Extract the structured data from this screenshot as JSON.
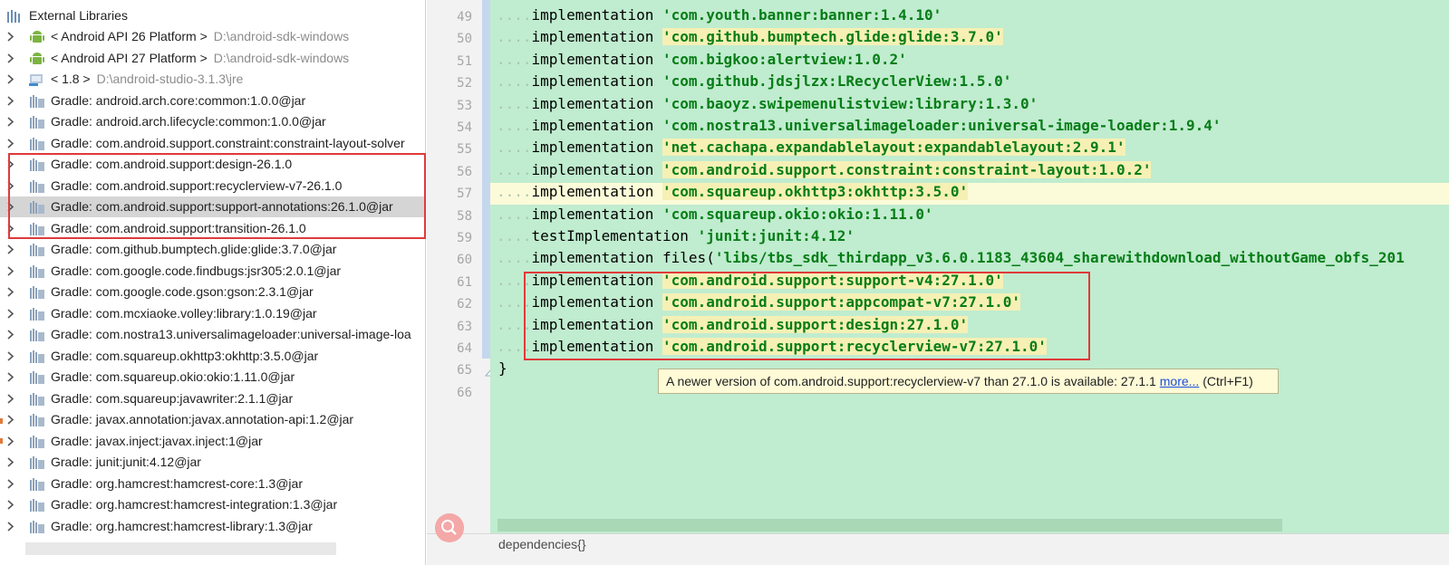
{
  "tree": {
    "root": {
      "label": "External Libraries",
      "icon": "library-icon"
    },
    "items": [
      {
        "label": "< Android API 26 Platform >",
        "path": "D:\\android-sdk-windows",
        "icon": "android-icon"
      },
      {
        "label": "< Android API 27 Platform >",
        "path": "D:\\android-sdk-windows",
        "icon": "android-icon"
      },
      {
        "label": "< 1.8 >",
        "path": "D:\\android-studio-3.1.3\\jre",
        "icon": "jdk-icon"
      },
      {
        "label": "Gradle: android.arch.core:common:1.0.0@jar",
        "path": "",
        "icon": "jar-library-icon"
      },
      {
        "label": "Gradle: android.arch.lifecycle:common:1.0.0@jar",
        "path": "",
        "icon": "jar-library-icon"
      },
      {
        "label": "Gradle: com.android.support.constraint:constraint-layout-solver",
        "path": "",
        "icon": "jar-library-icon"
      },
      {
        "label": "Gradle: com.android.support:design-26.1.0",
        "path": "",
        "icon": "jar-library-icon"
      },
      {
        "label": "Gradle: com.android.support:recyclerview-v7-26.1.0",
        "path": "",
        "icon": "jar-library-icon"
      },
      {
        "label": "Gradle: com.android.support:support-annotations:26.1.0@jar",
        "path": "",
        "icon": "jar-library-icon"
      },
      {
        "label": "Gradle: com.android.support:transition-26.1.0",
        "path": "",
        "icon": "jar-library-icon"
      },
      {
        "label": "Gradle: com.github.bumptech.glide:glide:3.7.0@jar",
        "path": "",
        "icon": "jar-library-icon"
      },
      {
        "label": "Gradle: com.google.code.findbugs:jsr305:2.0.1@jar",
        "path": "",
        "icon": "jar-library-icon"
      },
      {
        "label": "Gradle: com.google.code.gson:gson:2.3.1@jar",
        "path": "",
        "icon": "jar-library-icon"
      },
      {
        "label": "Gradle: com.mcxiaoke.volley:library:1.0.19@jar",
        "path": "",
        "icon": "jar-library-icon"
      },
      {
        "label": "Gradle: com.nostra13.universalimageloader:universal-image-loa",
        "path": "",
        "icon": "jar-library-icon"
      },
      {
        "label": "Gradle: com.squareup.okhttp3:okhttp:3.5.0@jar",
        "path": "",
        "icon": "jar-library-icon"
      },
      {
        "label": "Gradle: com.squareup.okio:okio:1.11.0@jar",
        "path": "",
        "icon": "jar-library-icon"
      },
      {
        "label": "Gradle: com.squareup:javawriter:2.1.1@jar",
        "path": "",
        "icon": "jar-library-icon"
      },
      {
        "label": "Gradle: javax.annotation:javax.annotation-api:1.2@jar",
        "path": "",
        "icon": "jar-library-icon"
      },
      {
        "label": "Gradle: javax.inject:javax.inject:1@jar",
        "path": "",
        "icon": "jar-library-icon"
      },
      {
        "label": "Gradle: junit:junit:4.12@jar",
        "path": "",
        "icon": "jar-library-icon"
      },
      {
        "label": "Gradle: org.hamcrest:hamcrest-core:1.3@jar",
        "path": "",
        "icon": "jar-library-icon"
      },
      {
        "label": "Gradle: org.hamcrest:hamcrest-integration:1.3@jar",
        "path": "",
        "icon": "jar-library-icon"
      },
      {
        "label": "Gradle: org.hamcrest:hamcrest-library:1.3@jar",
        "path": "",
        "icon": "jar-library-icon"
      }
    ]
  },
  "editor": {
    "lines": [
      {
        "num": "49",
        "kw": "implementation ",
        "str": "'com.youth.banner:banner:1.4.10'",
        "hl": false
      },
      {
        "num": "50",
        "kw": "implementation ",
        "str": "'com.github.bumptech.glide:glide:3.7.0'",
        "hl": true
      },
      {
        "num": "51",
        "kw": "implementation ",
        "str": "'com.bigkoo:alertview:1.0.2'",
        "hl": false
      },
      {
        "num": "52",
        "kw": "implementation ",
        "str": "'com.github.jdsjlzx:LRecyclerView:1.5.0'",
        "hl": false
      },
      {
        "num": "53",
        "kw": "implementation ",
        "str": "'com.baoyz.swipemenulistview:library:1.3.0'",
        "hl": false
      },
      {
        "num": "54",
        "kw": "implementation ",
        "str": "'com.nostra13.universalimageloader:universal-image-loader:1.9.4'",
        "hl": false
      },
      {
        "num": "55",
        "kw": "implementation ",
        "str": "'net.cachapa.expandablelayout:expandablelayout:2.9.1'",
        "hl": true
      },
      {
        "num": "56",
        "kw": "implementation ",
        "str": "'com.android.support.constraint:constraint-layout:1.0.2'",
        "hl": true
      },
      {
        "num": "57",
        "kw": "implementation ",
        "str": "'com.squareup.okhttp3:okhttp:3.5.0'",
        "hl": true
      },
      {
        "num": "58",
        "kw": "implementation ",
        "str": "'com.squareup.okio:okio:1.11.0'",
        "hl": false
      },
      {
        "num": "59",
        "kw": "testImplementation ",
        "str": "'junit:junit:4.12'",
        "hl": false
      },
      {
        "num": "60",
        "kw": "implementation files(",
        "str": "'libs/tbs_sdk_thirdapp_v3.6.0.1183_43604_sharewithdownload_withoutGame_obfs_201",
        "hl": false
      },
      {
        "num": "61",
        "kw": "implementation ",
        "str": "'com.android.support:support-v4:27.1.0'",
        "hl": true
      },
      {
        "num": "62",
        "kw": "implementation ",
        "str": "'com.android.support:appcompat-v7:27.1.0'",
        "hl": true
      },
      {
        "num": "63",
        "kw": "implementation ",
        "str": "'com.android.support:design:27.1.0'",
        "hl": true
      },
      {
        "num": "64",
        "kw": "implementation ",
        "str": "'com.android.support:recyclerview-v7:27.1.0'",
        "hl": true
      }
    ],
    "closing": {
      "num": "65",
      "text": "}"
    },
    "empty": {
      "num": "66"
    },
    "current_line": "57"
  },
  "tooltip": {
    "text": "A newer version of com.android.support:recyclerview-v7 than 27.1.0 is available: 27.1.1 ",
    "link": "more...",
    "shortcut": " (Ctrl+F1)"
  },
  "breadcrumb": "dependencies{}",
  "colors": {
    "editor_bg": "#c0eccf",
    "string": "#067d17",
    "highlight": "#f6f0b5",
    "annotation_red": "#e03a3a"
  }
}
